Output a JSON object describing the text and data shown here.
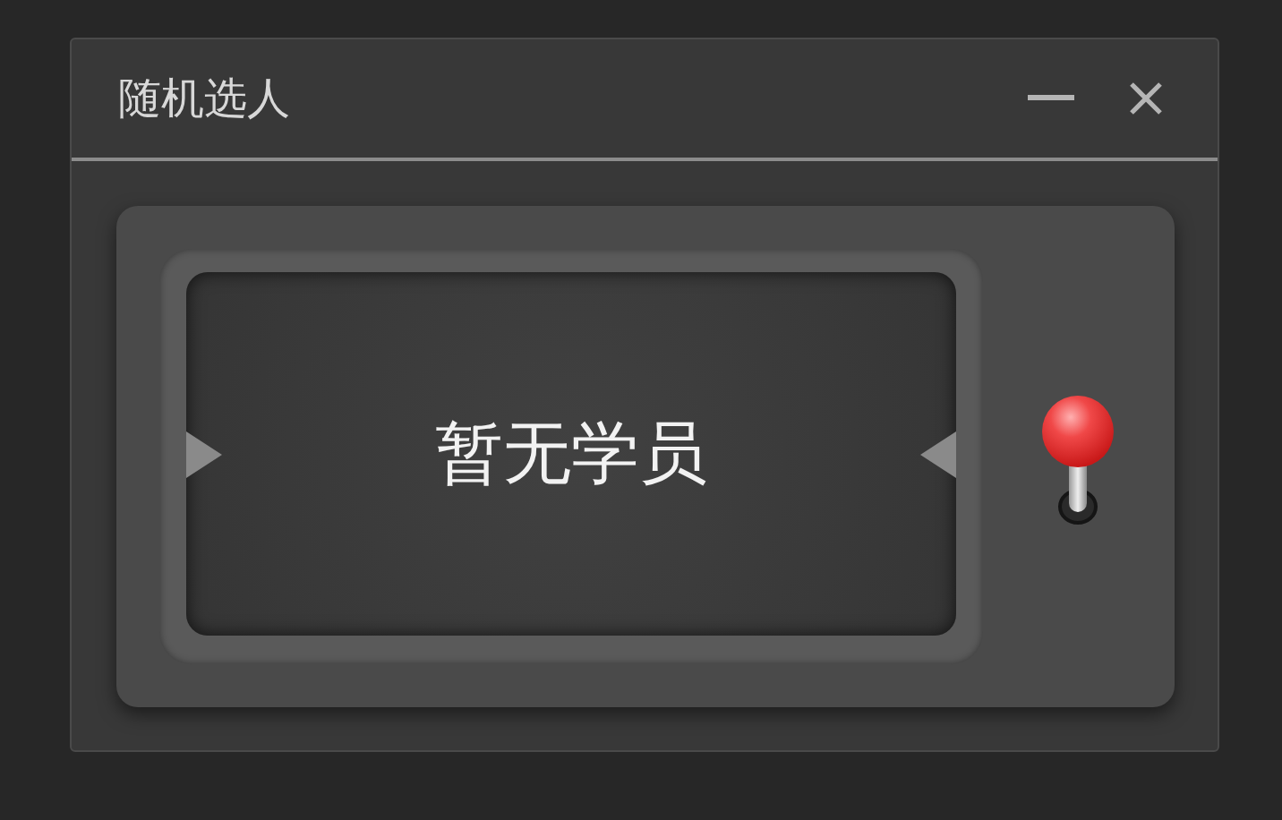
{
  "window": {
    "title": "随机选人"
  },
  "display": {
    "text": "暂无学员"
  }
}
